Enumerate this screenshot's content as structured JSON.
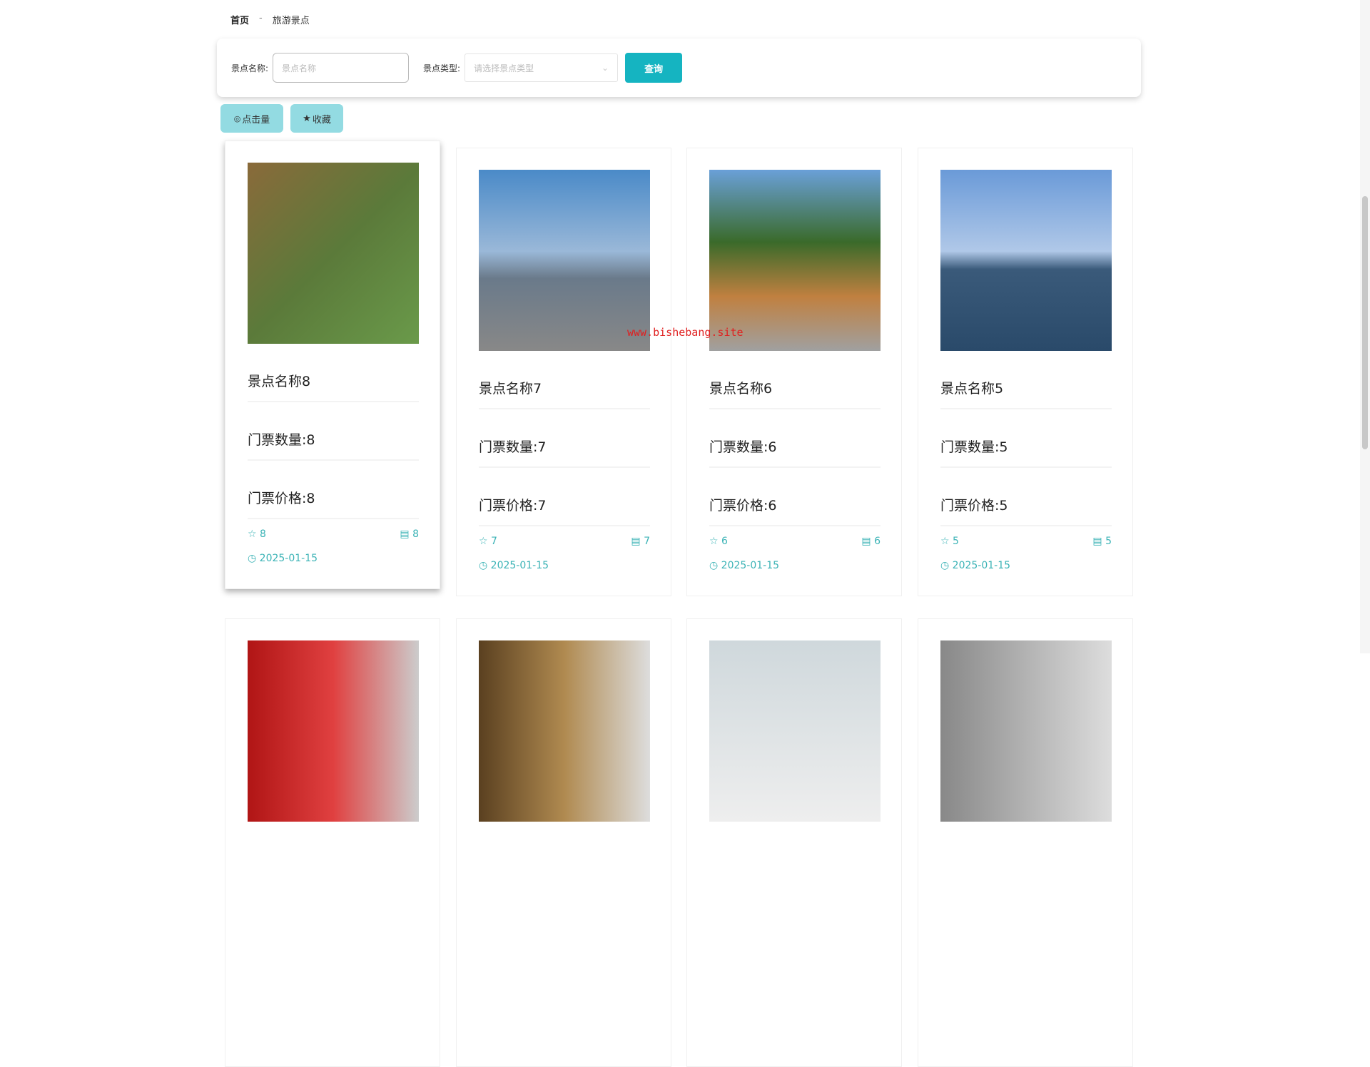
{
  "breadcrumb": {
    "home": "首页",
    "sep": "-",
    "current": "旅游景点"
  },
  "search": {
    "name_label": "景点名称:",
    "name_placeholder": "景点名称",
    "type_label": "景点类型:",
    "type_placeholder": "请选择景点类型",
    "query_button": "查询"
  },
  "sort": {
    "clicks": "点击量",
    "favorites": "收藏"
  },
  "watermark": "www.bishebang.site",
  "cards": [
    {
      "title": "景点名称8",
      "tickets": "门票数量:8",
      "price": "门票价格:8",
      "stars": "8",
      "comments": "8",
      "date": "2025-01-15"
    },
    {
      "title": "景点名称7",
      "tickets": "门票数量:7",
      "price": "门票价格:7",
      "stars": "7",
      "comments": "7",
      "date": "2025-01-15"
    },
    {
      "title": "景点名称6",
      "tickets": "门票数量:6",
      "price": "门票价格:6",
      "stars": "6",
      "comments": "6",
      "date": "2025-01-15"
    },
    {
      "title": "景点名称5",
      "tickets": "门票数量:5",
      "price": "门票价格:5",
      "stars": "5",
      "comments": "5",
      "date": "2025-01-15"
    }
  ],
  "colors": {
    "accent": "#15b4c1",
    "stat": "#3bb3b6"
  }
}
